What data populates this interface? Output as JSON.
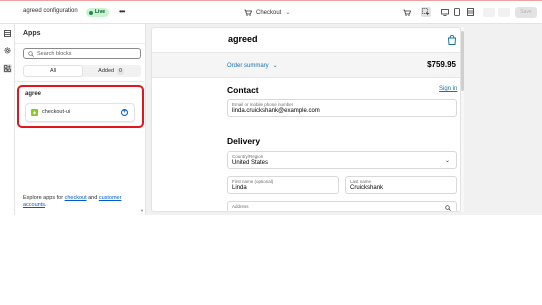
{
  "topbar": {
    "title": "agreed configuration",
    "live_label": "Live",
    "more_label": "•••",
    "page_selector": "Checkout",
    "save_label": "Save"
  },
  "apps_panel": {
    "title": "Apps",
    "search_placeholder": "Search blocks",
    "tabs": [
      {
        "label": "All",
        "active": true
      },
      {
        "label": "Added",
        "count": "0",
        "active": false
      }
    ],
    "app_group": {
      "name": "agree",
      "blocks": [
        {
          "label": "checkout-ui"
        }
      ]
    },
    "footer": {
      "prefix": "Explore apps for ",
      "link_checkout": "checkout",
      "middle": " and ",
      "link_accounts": "customer accounts",
      "suffix": "."
    }
  },
  "checkout_preview": {
    "shop_name": "agreed",
    "order_summary_label": "Order summary",
    "total": "$759.95",
    "contact": {
      "title": "Contact",
      "sign_in_label": "Sign in",
      "email_label": "Email or mobile phone number",
      "email_value": "linda.cruickshank@example.com"
    },
    "delivery": {
      "title": "Delivery",
      "country_label": "Country/Region",
      "country_value": "United States",
      "first_name_label": "First name (optional)",
      "first_name_value": "Linda",
      "last_name_label": "Last name",
      "last_name_value": "Cruickshank",
      "address_label": "Address"
    }
  },
  "colors": {
    "accent_link": "#1773b0",
    "highlight_border": "#e3161e",
    "live_badge_bg": "#c8f4d0"
  }
}
